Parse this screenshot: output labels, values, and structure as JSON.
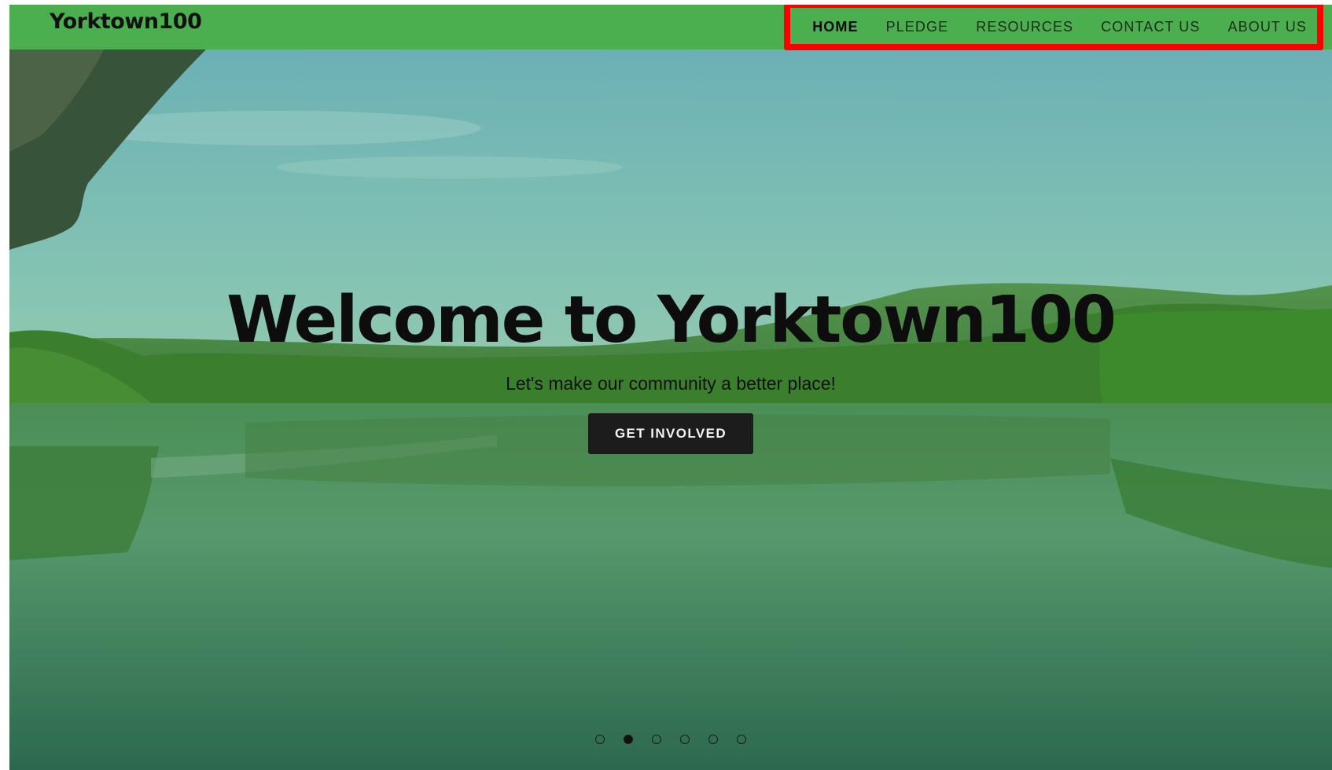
{
  "site": {
    "logo": "Yorktown100"
  },
  "nav": {
    "items": [
      {
        "label": "HOME",
        "active": true
      },
      {
        "label": "PLEDGE",
        "active": false
      },
      {
        "label": "RESOURCES",
        "active": false
      },
      {
        "label": "CONTACT US",
        "active": false
      },
      {
        "label": "ABOUT US",
        "active": false
      }
    ]
  },
  "hero": {
    "title": "Welcome to Yorktown100",
    "subtitle": "Let's make our community a better place!",
    "cta_label": "GET INVOLVED"
  },
  "carousel": {
    "slide_count": 6,
    "active_index": 1
  },
  "colors": {
    "brand_green": "#4caf4f",
    "highlight_red": "#ff0000",
    "button_dark": "#1c1c1c"
  }
}
